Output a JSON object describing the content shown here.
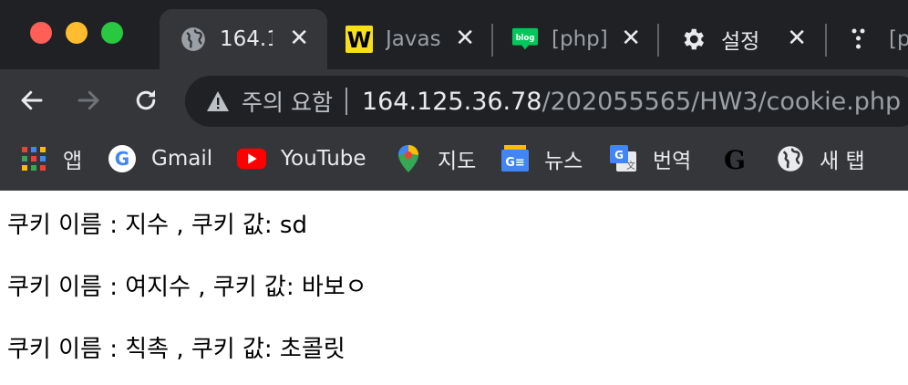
{
  "tabs": [
    {
      "title": "164.1",
      "icon": "globe-icon",
      "active": true
    },
    {
      "title": "Javas",
      "icon": "w3schools-icon",
      "active": false
    },
    {
      "title": "[php]",
      "icon": "blog-icon",
      "active": false
    },
    {
      "title": "설정",
      "icon": "gear-icon",
      "active": false
    },
    {
      "title": "[p",
      "icon": "apps-icon",
      "active": false
    }
  ],
  "tab_close_glyph": "✕",
  "omnibox": {
    "security_label": "주의 요함",
    "url_host": "164.125.36.78",
    "url_path": "/202055565/HW3/cookie.php"
  },
  "bookmarks": [
    {
      "label": "앱",
      "icon": "apps-grid-icon"
    },
    {
      "label": "Gmail",
      "icon": "google-icon"
    },
    {
      "label": "YouTube",
      "icon": "youtube-icon"
    },
    {
      "label": "지도",
      "icon": "maps-pin-icon"
    },
    {
      "label": "뉴스",
      "icon": "news-icon"
    },
    {
      "label": "번역",
      "icon": "translate-icon"
    },
    {
      "label": "",
      "icon": "g-logo-icon"
    },
    {
      "label": "새 탭",
      "icon": "globe-icon"
    }
  ],
  "content": {
    "lines": [
      "쿠키 이름 : 지수 , 쿠키 값: sd",
      "쿠키 이름 : 여지수 , 쿠키 값: 바보ㅇ",
      "쿠키 이름 : 칙촉 , 쿠키 값: 초콜릿"
    ]
  },
  "colors": {
    "chrome_dark": "#202124",
    "chrome_toolbar": "#35363a",
    "text_light": "#e8eaed"
  }
}
